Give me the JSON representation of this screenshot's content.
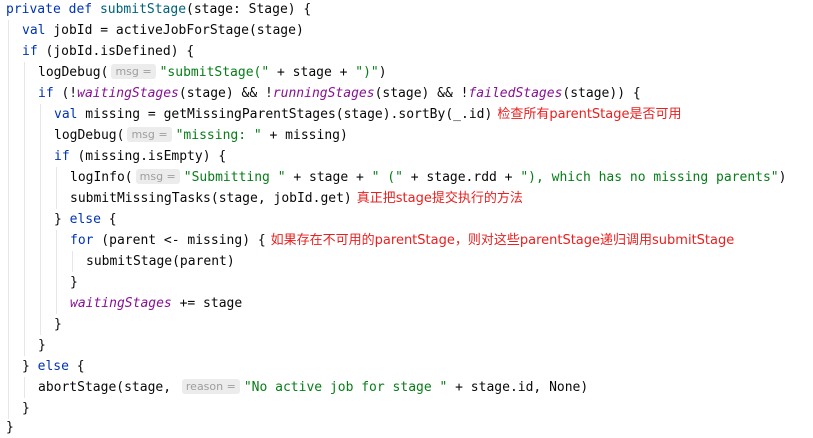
{
  "code": {
    "l1": {
      "kw1": "private",
      "kw2": "def",
      "fn": "submitStage",
      "rest": "(stage: Stage) {"
    },
    "l2": {
      "kw": "val",
      "rest": " jobId = activeJobForStage(stage)"
    },
    "l3": {
      "kw": "if",
      "rest": " (jobId.isDefined) {"
    },
    "l4": {
      "a": "logDebug(",
      "hint": "msg =",
      "str": "\"submitStage(\"",
      "b": " + stage + ",
      "str2": "\")\"",
      "c": ")"
    },
    "l5": {
      "kw": "if",
      "a": " (!",
      "f1": "waitingStages",
      "b": "(stage) && !",
      "f2": "runningStages",
      "c": "(stage) && !",
      "f3": "failedStages",
      "d": "(stage)) {"
    },
    "l6": {
      "kw": "val",
      "rest": " missing = getMissingParentStages(stage).sortBy(_.id)",
      "note": "检查所有parentStage是否可用"
    },
    "l7": {
      "a": "logDebug(",
      "hint": "msg =",
      "str": "\"missing: \"",
      "b": " + missing)"
    },
    "l8": {
      "kw": "if",
      "rest": " (missing.isEmpty) {"
    },
    "l9": {
      "a": "logInfo(",
      "hint": "msg =",
      "str": "\"Submitting \"",
      "b": " + stage + ",
      "str2": "\" (\"",
      "c": " + stage.rdd + ",
      "str3": "\"), which has no missing parents\"",
      "d": ")"
    },
    "l10": {
      "rest": "submitMissingTasks(stage, jobId.get)",
      "note": "真正把stage提交执行的方法"
    },
    "l11": {
      "a": "} ",
      "kw": "else",
      "b": " {"
    },
    "l12": {
      "kw": "for",
      "rest": " (parent <- missing) {",
      "note": "如果存在不可用的parentStage，则对这些parentStage递归调用submitStage"
    },
    "l13": {
      "rest": "submitStage(parent)"
    },
    "l14": {
      "rest": "}"
    },
    "l15": {
      "f": "waitingStages",
      "rest": " += stage"
    },
    "l16": {
      "rest": "}"
    },
    "l17": {
      "rest": "}"
    },
    "l18": {
      "a": "} ",
      "kw": "else",
      "b": " {"
    },
    "l19": {
      "a": "abortStage(stage, ",
      "hint": "reason =",
      "str": "\"No active job for stage \"",
      "b": " + stage.id, None)"
    },
    "l20": {
      "rest": "}"
    },
    "l21": {
      "rest": "}"
    }
  }
}
